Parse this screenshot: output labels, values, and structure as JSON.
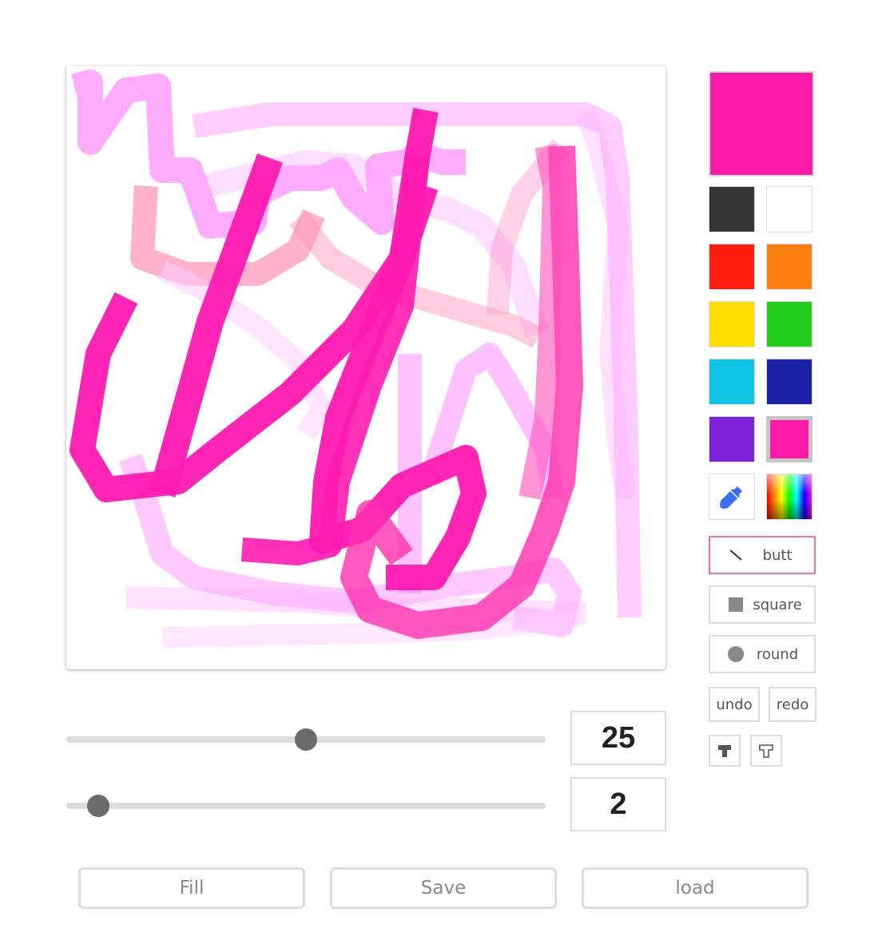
{
  "canvas": {
    "label": ""
  },
  "palette": {
    "current_color": "#ff19a8",
    "swatches": [
      "#353535",
      "#ffffff",
      "#ff1d10",
      "#ff7f10",
      "#ffdd00",
      "#22cc1a",
      "#10c4e4",
      "#1a21a8",
      "#7e22d8",
      "#ff19a8"
    ],
    "selected_index": 9
  },
  "tools": {
    "eyedropper": "eyedropper-icon",
    "rainbow": "rainbow-gradient-icon"
  },
  "line_caps": [
    {
      "label": "butt",
      "icon": "diagonal-line-icon",
      "active": true
    },
    {
      "label": "square",
      "icon": "square-icon",
      "active": false
    },
    {
      "label": "round",
      "icon": "circle-icon",
      "active": false
    }
  ],
  "history": {
    "undo": "undo",
    "redo": "redo"
  },
  "text_tools": {
    "bold": "bold-text-icon",
    "outline": "outline-text-icon"
  },
  "sliders": {
    "size": {
      "value": "25",
      "fraction": 0.5
    },
    "opacity": {
      "value": "2",
      "fraction": 0.035
    }
  },
  "actions": {
    "fill": "Fill",
    "save": "Save",
    "load": "load"
  }
}
